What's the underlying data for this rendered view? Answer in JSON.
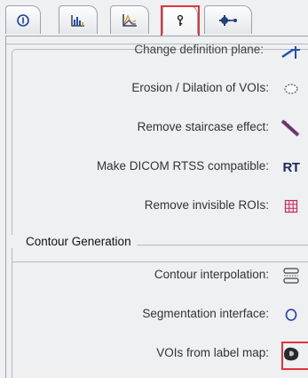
{
  "tabs": [
    {
      "icon": "info-icon"
    },
    {
      "icon": "bar-chart-icon"
    },
    {
      "icon": "line-chart-icon"
    },
    {
      "icon": "vertical-tool-icon",
      "active": true
    },
    {
      "icon": "gear-arrow-icon"
    }
  ],
  "rows_top": [
    {
      "label": "Change definition plane:",
      "icon": "arrow-plane-icon"
    },
    {
      "label": "Erosion / Dilation of VOIs:",
      "icon": "dashed-circle-icon"
    },
    {
      "label": "Remove staircase effect:",
      "icon": "staircase-icon"
    },
    {
      "label": "Make DICOM RTSS compatible:",
      "icon": "rt-icon",
      "icon_text": "RT"
    },
    {
      "label": "Remove invisible ROIs:",
      "icon": "grid-icon"
    }
  ],
  "contour_generation": {
    "title": "Contour Generation",
    "rows": [
      {
        "label": "Contour interpolation:",
        "icon": "interpolation-icon"
      },
      {
        "label": "Segmentation interface:",
        "icon": "circle-icon"
      },
      {
        "label": "VOIs from label map:",
        "icon": "label-map-icon"
      }
    ]
  },
  "colors": {
    "highlight": "#e0353b",
    "accent_blue": "#1f4fb5",
    "panel_bg": "#eef0f2"
  }
}
